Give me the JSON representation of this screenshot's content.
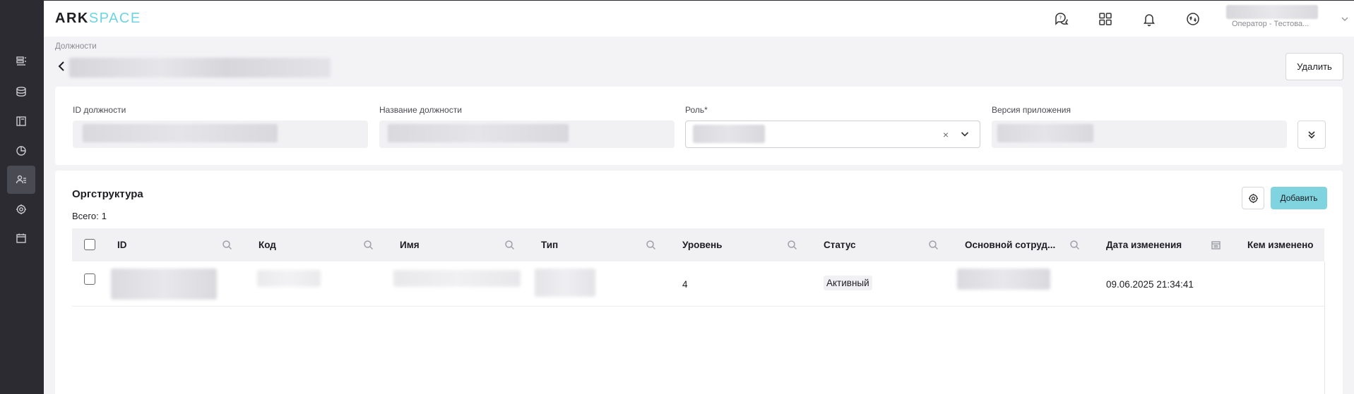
{
  "app": {
    "logo_ark": "ARK",
    "logo_space": "SPACE",
    "user_role": "Оператор - Тестова..."
  },
  "nav": {
    "items": [
      {
        "icon": "list-icon"
      },
      {
        "icon": "database-icon"
      },
      {
        "icon": "book-icon"
      },
      {
        "icon": "chart-icon"
      },
      {
        "icon": "users-icon",
        "active": true
      },
      {
        "icon": "settings-icon"
      },
      {
        "icon": "calendar-icon"
      }
    ]
  },
  "header_icons": [
    "support-chat-icon",
    "apps-grid-icon",
    "bell-icon",
    "sync-icon"
  ],
  "page": {
    "breadcrumb": "Должности",
    "delete_label": "Удалить"
  },
  "form": {
    "id_label": "ID должности",
    "name_label": "Название должности",
    "role_label": "Роль*",
    "version_label": "Версия приложения",
    "clear_symbol": "×"
  },
  "orgstructure": {
    "title": "Оргструктура",
    "total_label": "Всего:",
    "total_value": "1",
    "add_label": "Добавить",
    "columns": {
      "id": "ID",
      "code": "Код",
      "name": "Имя",
      "type": "Тип",
      "level": "Уровень",
      "status": "Статус",
      "main_employee": "Основной сотруд...",
      "modified_date": "Дата изменения",
      "modified_by": "Кем изменено"
    },
    "rows": [
      {
        "level": "4",
        "status": "Активный",
        "modified_date": "09.06.2025 21:34:41"
      }
    ]
  },
  "colors": {
    "accent": "#7fd4df",
    "rail": "#2b2b31",
    "background": "#f3f3f6"
  }
}
